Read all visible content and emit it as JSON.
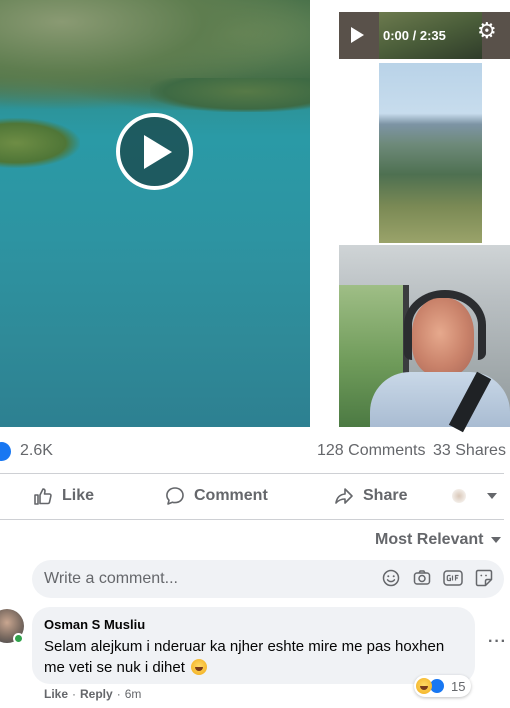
{
  "video": {
    "time_display": "0:00 / 2:35"
  },
  "post_stats": {
    "reactions_count": "2.6K",
    "comments": "128 Comments",
    "shares": "33 Shares"
  },
  "actions": {
    "like": "Like",
    "comment": "Comment",
    "share": "Share"
  },
  "comments_section": {
    "sort_label": "Most Relevant",
    "composer_placeholder": "Write a comment..."
  },
  "comment": {
    "author": "Osman S Musliu",
    "text": "Selam alejkum i nderuar ka njher eshte mire me pas hoxhen me veti se nuk i dihet",
    "reaction_count": "15",
    "like_label": "Like",
    "separator": "·",
    "reply_label": "Reply",
    "time": "6m",
    "more": "···"
  },
  "icons": {
    "play": "play-icon",
    "settings": "gear-icon",
    "like": "thumbs-up-icon",
    "comment": "speech-bubble-icon",
    "share": "share-arrow-icon",
    "emoji": "smiley-icon",
    "camera": "camera-icon",
    "gif": "gif-icon",
    "sticker": "sticker-icon"
  },
  "colors": {
    "accent": "#1877f2",
    "secondary_text": "#65676b",
    "bubble_bg": "#f0f2f5",
    "online": "#31a24c"
  }
}
